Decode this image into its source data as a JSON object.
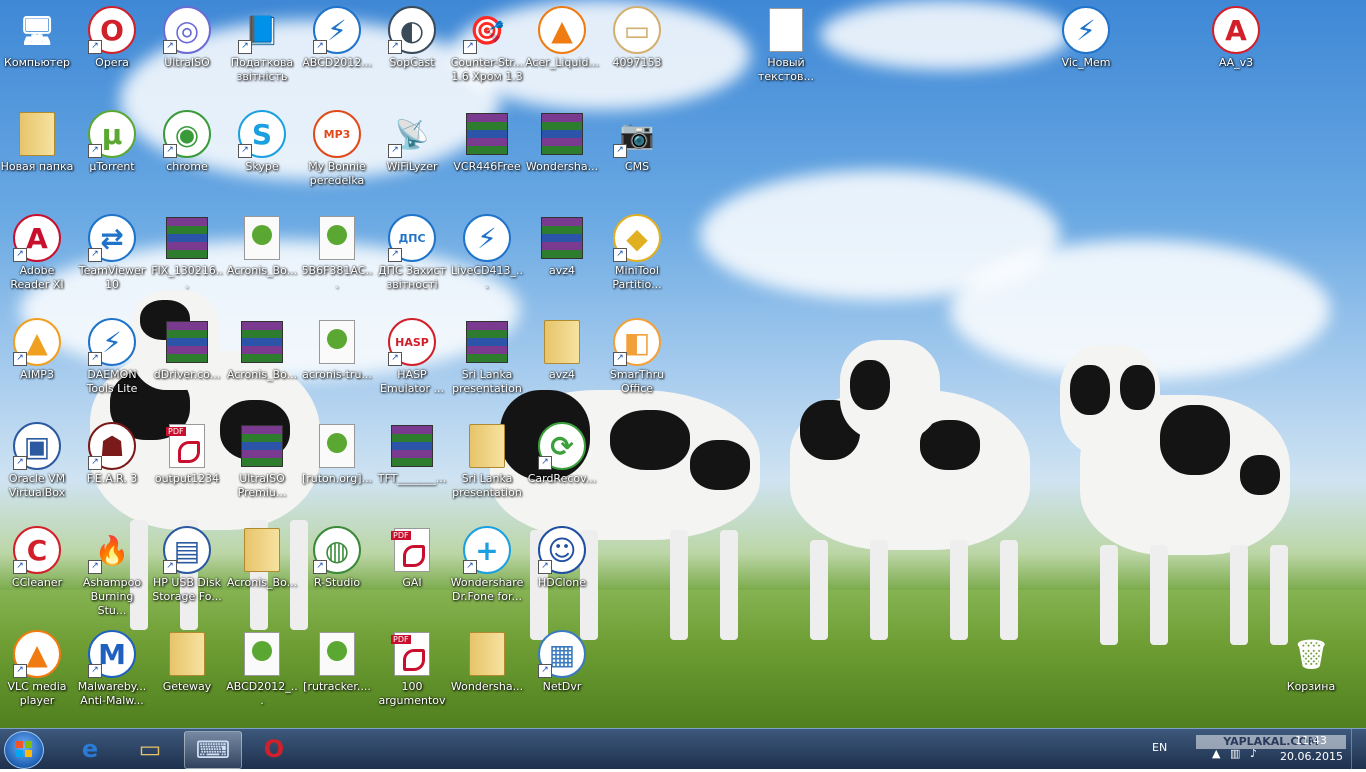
{
  "desktop": {
    "icons": [
      {
        "label": "Компьютер",
        "name": "computer-icon",
        "col": 0,
        "row": 0,
        "glyph": "🖥",
        "shortcut": false
      },
      {
        "label": "Opera",
        "name": "opera-icon",
        "col": 1,
        "row": 0,
        "glyph": "O",
        "color": "#d1202a",
        "shortcut": true
      },
      {
        "label": "UltraISO",
        "name": "ultraiso-icon",
        "col": 2,
        "row": 0,
        "glyph": "◎",
        "color": "#6b6bd6",
        "shortcut": true
      },
      {
        "label": "Податкова звітність",
        "name": "tax-report-icon",
        "col": 3,
        "row": 0,
        "glyph": "📘",
        "shortcut": true
      },
      {
        "label": "ABCD2012...",
        "name": "daemon-abcd-icon",
        "col": 4,
        "row": 0,
        "glyph": "⚡",
        "color": "#1f73c9",
        "shortcut": true
      },
      {
        "label": "SopCast",
        "name": "sopcast-icon",
        "col": 5,
        "row": 0,
        "glyph": "◐",
        "color": "#3a4a5a",
        "shortcut": true
      },
      {
        "label": "Counter-Str... 1.6 Хром 1.3",
        "name": "counter-strike-icon",
        "col": 6,
        "row": 0,
        "glyph": "🎯",
        "shortcut": true
      },
      {
        "label": "Acer_Liquid...",
        "name": "vlc-acer-icon",
        "col": 7,
        "row": 0,
        "glyph": "▲",
        "color": "#f07b10",
        "shortcut": false
      },
      {
        "label": "4097153",
        "name": "image-file-icon",
        "col": 8,
        "row": 0,
        "glyph": "▭",
        "color": "#d4b070",
        "shortcut": false
      },
      {
        "label": "Новый текстов...",
        "name": "text-document-icon",
        "col": 10,
        "row": 0,
        "glyph": "doc",
        "shortcut": false
      },
      {
        "label": "Vic_Mem",
        "name": "vic-mem-icon",
        "col": 14,
        "row": 0,
        "glyph": "⚡",
        "color": "#1f73c9",
        "shortcut": false
      },
      {
        "label": "AA_v3",
        "name": "ammyy-admin-icon",
        "col": 16,
        "row": 0,
        "glyph": "A",
        "color": "#d1202a",
        "shortcut": false
      },
      {
        "label": "Новая папка",
        "name": "new-folder-icon",
        "col": 0,
        "row": 1,
        "glyph": "folder",
        "shortcut": false
      },
      {
        "label": "µTorrent",
        "name": "utorrent-icon",
        "col": 1,
        "row": 1,
        "glyph": "µ",
        "color": "#5aa832",
        "shortcut": true
      },
      {
        "label": "chrome",
        "name": "chrome-icon",
        "col": 2,
        "row": 1,
        "glyph": "◉",
        "color": "#3a9a3a",
        "shortcut": true
      },
      {
        "label": "Skype",
        "name": "skype-icon",
        "col": 3,
        "row": 1,
        "glyph": "S",
        "color": "#1aa0e0",
        "shortcut": true
      },
      {
        "label": "My Bonnie peredelka",
        "name": "mp3-file-icon",
        "col": 4,
        "row": 1,
        "glyph": "MP3",
        "color": "#e04a1a",
        "shortcut": false
      },
      {
        "label": "WiFiLyzer",
        "name": "wifilyzer-icon",
        "col": 5,
        "row": 1,
        "glyph": "📡",
        "shortcut": true
      },
      {
        "label": "VCR446Free",
        "name": "vcr446free-icon",
        "col": 6,
        "row": 1,
        "glyph": "rar",
        "shortcut": false
      },
      {
        "label": "Wondersha...",
        "name": "wondershare-archive-icon",
        "col": 7,
        "row": 1,
        "glyph": "rar",
        "shortcut": false
      },
      {
        "label": "CMS",
        "name": "cms-webcam-icon",
        "col": 8,
        "row": 1,
        "glyph": "📷",
        "shortcut": true
      },
      {
        "label": "Adobe Reader XI",
        "name": "adobe-reader-icon",
        "col": 0,
        "row": 2,
        "glyph": "A",
        "color": "#c8102e",
        "shortcut": true
      },
      {
        "label": "TeamViewer 10",
        "name": "teamviewer-icon",
        "col": 1,
        "row": 2,
        "glyph": "⇄",
        "color": "#1f73c9",
        "shortcut": true
      },
      {
        "label": "FIX_130216...",
        "name": "fix-archive-icon",
        "col": 2,
        "row": 2,
        "glyph": "rar",
        "shortcut": false
      },
      {
        "label": "Acronis_Bo...",
        "name": "acronis-torrent-icon",
        "col": 3,
        "row": 2,
        "glyph": "torrent",
        "shortcut": false
      },
      {
        "label": "5B6F381AC...",
        "name": "torrent-file-icon",
        "col": 4,
        "row": 2,
        "glyph": "torrent",
        "shortcut": false
      },
      {
        "label": "ДПС Захист звітності",
        "name": "dps-zakhyst-icon",
        "col": 5,
        "row": 2,
        "glyph": "ДПС",
        "color": "#1f73c9",
        "shortcut": true
      },
      {
        "label": "LiveCD413_...",
        "name": "livecd-icon",
        "col": 6,
        "row": 2,
        "glyph": "⚡",
        "color": "#1f73c9",
        "shortcut": false
      },
      {
        "label": "avz4",
        "name": "avz4-archive-icon",
        "col": 7,
        "row": 2,
        "glyph": "rar",
        "shortcut": false
      },
      {
        "label": "MiniTool Partitio...",
        "name": "minitool-partition-icon",
        "col": 8,
        "row": 2,
        "glyph": "◆",
        "color": "#e0b020",
        "shortcut": true
      },
      {
        "label": "AIMP3",
        "name": "aimp3-icon",
        "col": 0,
        "row": 3,
        "glyph": "▲",
        "color": "#f0a020",
        "shortcut": true
      },
      {
        "label": "DAEMON Tools Lite",
        "name": "daemon-tools-icon",
        "col": 1,
        "row": 3,
        "glyph": "⚡",
        "color": "#1f73c9",
        "shortcut": true
      },
      {
        "label": "dDriver.co...",
        "name": "ddriver-archive-icon",
        "col": 2,
        "row": 3,
        "glyph": "rar",
        "shortcut": false
      },
      {
        "label": "Acronis_Bo...",
        "name": "acronis-archive-icon",
        "col": 3,
        "row": 3,
        "glyph": "rar",
        "shortcut": false
      },
      {
        "label": "acronis-tru...",
        "name": "acronis-true-torrent-icon",
        "col": 4,
        "row": 3,
        "glyph": "torrent",
        "shortcut": false
      },
      {
        "label": "HASP Emulator ...",
        "name": "hasp-emulator-icon",
        "col": 5,
        "row": 3,
        "glyph": "HASP",
        "color": "#d1202a",
        "shortcut": true
      },
      {
        "label": "Sri Lanka presentation",
        "name": "sri-lanka-archive-icon",
        "col": 6,
        "row": 3,
        "glyph": "rar",
        "shortcut": false
      },
      {
        "label": "avz4",
        "name": "avz4-folder-icon",
        "col": 7,
        "row": 3,
        "glyph": "folder",
        "shortcut": false
      },
      {
        "label": "SmarThru Office",
        "name": "smarthru-office-icon",
        "col": 8,
        "row": 3,
        "glyph": "◧",
        "color": "#f2a03a",
        "shortcut": true
      },
      {
        "label": "Oracle VM VirtualBox",
        "name": "virtualbox-icon",
        "col": 0,
        "row": 4,
        "glyph": "▣",
        "color": "#2c5aa0",
        "shortcut": true
      },
      {
        "label": "F.E.A.R. 3",
        "name": "fear3-icon",
        "col": 1,
        "row": 4,
        "glyph": "☗",
        "color": "#7a1a1a",
        "shortcut": true
      },
      {
        "label": "output1234",
        "name": "output-pdf-icon",
        "col": 2,
        "row": 4,
        "glyph": "pdf",
        "shortcut": false
      },
      {
        "label": "UltraISO Premiu...",
        "name": "ultraiso-archive-icon",
        "col": 3,
        "row": 4,
        "glyph": "rar",
        "shortcut": false
      },
      {
        "label": "[ruton.org]...",
        "name": "ruton-torrent-icon",
        "col": 4,
        "row": 4,
        "glyph": "torrent",
        "shortcut": false
      },
      {
        "label": "TFT_______...",
        "name": "tft-archive-icon",
        "col": 5,
        "row": 4,
        "glyph": "rar",
        "shortcut": false
      },
      {
        "label": "Sri Lanka presentation",
        "name": "sri-lanka-folder-icon",
        "col": 6,
        "row": 4,
        "glyph": "folder",
        "shortcut": false
      },
      {
        "label": "CardRecov...",
        "name": "cardrecovery-icon",
        "col": 7,
        "row": 4,
        "glyph": "⟳",
        "color": "#3aa03a",
        "shortcut": true
      },
      {
        "label": "CCleaner",
        "name": "ccleaner-icon",
        "col": 0,
        "row": 5,
        "glyph": "C",
        "color": "#d1202a",
        "shortcut": true
      },
      {
        "label": "Ashampoo Burning Stu...",
        "name": "ashampoo-icon",
        "col": 1,
        "row": 5,
        "glyph": "🔥",
        "shortcut": true
      },
      {
        "label": "HP USB Disk Storage Fo...",
        "name": "hp-usb-format-icon",
        "col": 2,
        "row": 5,
        "glyph": "▤",
        "color": "#2c5aa0",
        "shortcut": true
      },
      {
        "label": "Acronis_Bo...",
        "name": "acronis-folder-icon",
        "col": 3,
        "row": 5,
        "glyph": "folder",
        "shortcut": false
      },
      {
        "label": "R-Studio",
        "name": "r-studio-icon",
        "col": 4,
        "row": 5,
        "glyph": "◍",
        "color": "#3a8a3a",
        "shortcut": true
      },
      {
        "label": "GAI",
        "name": "gai-pdf-icon",
        "col": 5,
        "row": 5,
        "glyph": "pdf",
        "shortcut": false
      },
      {
        "label": "Wondershare Dr.Fone for...",
        "name": "drfone-icon",
        "col": 6,
        "row": 5,
        "glyph": "+",
        "color": "#1aa0e0",
        "shortcut": true
      },
      {
        "label": "HDClone",
        "name": "hdclone-icon",
        "col": 7,
        "row": 5,
        "glyph": "☺",
        "color": "#1f4fa0",
        "shortcut": true
      },
      {
        "label": "VLC media player",
        "name": "vlc-icon",
        "col": 0,
        "row": 6,
        "glyph": "▲",
        "color": "#f07b10",
        "shortcut": true
      },
      {
        "label": "Malwareby... Anti-Malw...",
        "name": "malwarebytes-icon",
        "col": 1,
        "row": 6,
        "glyph": "M",
        "color": "#1f5fc0",
        "shortcut": true
      },
      {
        "label": "Geteway",
        "name": "geteway-folder-icon",
        "col": 2,
        "row": 6,
        "glyph": "folder",
        "shortcut": false
      },
      {
        "label": "ABCD2012_...",
        "name": "abcd-torrent-icon",
        "col": 3,
        "row": 6,
        "glyph": "torrent",
        "shortcut": false
      },
      {
        "label": "[rutracker....",
        "name": "rutracker-torrent-icon",
        "col": 4,
        "row": 6,
        "glyph": "torrent",
        "shortcut": false
      },
      {
        "label": "100 argumentov",
        "name": "argumentov-pdf-icon",
        "col": 5,
        "row": 6,
        "glyph": "pdf",
        "shortcut": false
      },
      {
        "label": "Wondersha...",
        "name": "wondershare-folder-icon",
        "col": 6,
        "row": 6,
        "glyph": "folder",
        "shortcut": false
      },
      {
        "label": "NetDvr",
        "name": "netdvr-icon",
        "col": 7,
        "row": 6,
        "glyph": "▦",
        "color": "#3a7ac0",
        "shortcut": true
      },
      {
        "label": "Корзина",
        "name": "recycle-bin-icon",
        "col": 17,
        "row": 6,
        "glyph": "🗑",
        "shortcut": false
      }
    ]
  },
  "taskbar": {
    "start_label": "Start",
    "pinned": [
      {
        "name": "taskbar-ie-icon",
        "glyph": "e",
        "color": "#2a7ad6"
      },
      {
        "name": "taskbar-explorer-icon",
        "glyph": "▭",
        "color": "#e7c46a"
      },
      {
        "name": "taskbar-keyboard-app-icon",
        "glyph": "⌨",
        "color": "#cfe0f5",
        "active": true
      },
      {
        "name": "taskbar-opera-icon",
        "glyph": "O",
        "color": "#d1202a"
      }
    ],
    "language": "EN",
    "clock_time": "11:43",
    "clock_date": "20.06.2015",
    "watermark": "YAPLAKAL.COM"
  }
}
